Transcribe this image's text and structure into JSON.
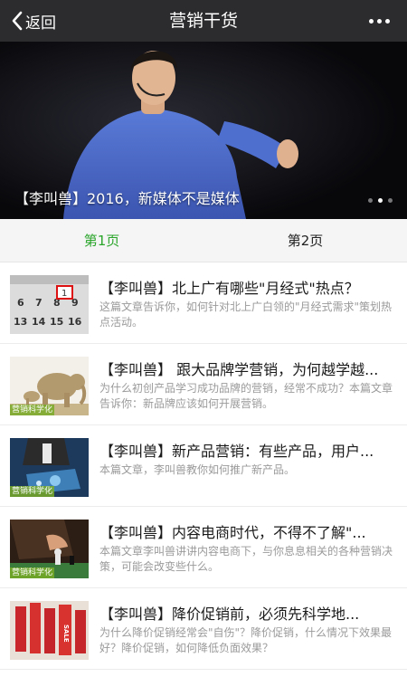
{
  "header": {
    "back_label": "返回",
    "title": "营销干货"
  },
  "banner": {
    "caption": "【李叫兽】2016，新媒体不是媒体"
  },
  "tabs": [
    {
      "label": "第1页",
      "active": true
    },
    {
      "label": "第2页",
      "active": false
    }
  ],
  "articles": [
    {
      "title": "【李叫兽】北上广有哪些\"月经式\"热点？",
      "desc": "这篇文章告诉你，如何针对北上广白领的\"月经式需求\"策划热点活动。",
      "thumb_icon": "calendar-icon",
      "thumb_tag": ""
    },
    {
      "title": "【李叫兽】 跟大品牌学营销，为何越学越...",
      "desc": "为什么初创产品学习成功品牌的营销，经常不成功？本篇文章告诉你：新品牌应该如何开展营销。",
      "thumb_icon": "elephant-icon",
      "thumb_tag": "营销科学化"
    },
    {
      "title": "【李叫兽】新产品营销：有些产品，用户...",
      "desc": "本篇文章，李叫兽教你如何推广新产品。",
      "thumb_icon": "tablet-icon",
      "thumb_tag": "营销科学化"
    },
    {
      "title": "【李叫兽】内容电商时代，不得不了解\"...",
      "desc": "本篇文章李叫兽讲讲内容电商下，与你息息相关的各种营销决策，可能会改变些什么。",
      "thumb_icon": "chess-icon",
      "thumb_tag": "营销科学化"
    },
    {
      "title": "【李叫兽】降价促销前，必须先科学地...",
      "desc": "为什么降价促销经常会\"自伤\"？降价促销，什么情况下效果最好？降价促销，如何降低负面效果？",
      "thumb_icon": "sale-tags-icon",
      "thumb_tag": ""
    }
  ],
  "colors": {
    "navbar_bg": "#2c2c2e",
    "active_tab": "#2aa52a",
    "title_text": "#1a1a1a",
    "desc_text": "#9a9a9a"
  }
}
